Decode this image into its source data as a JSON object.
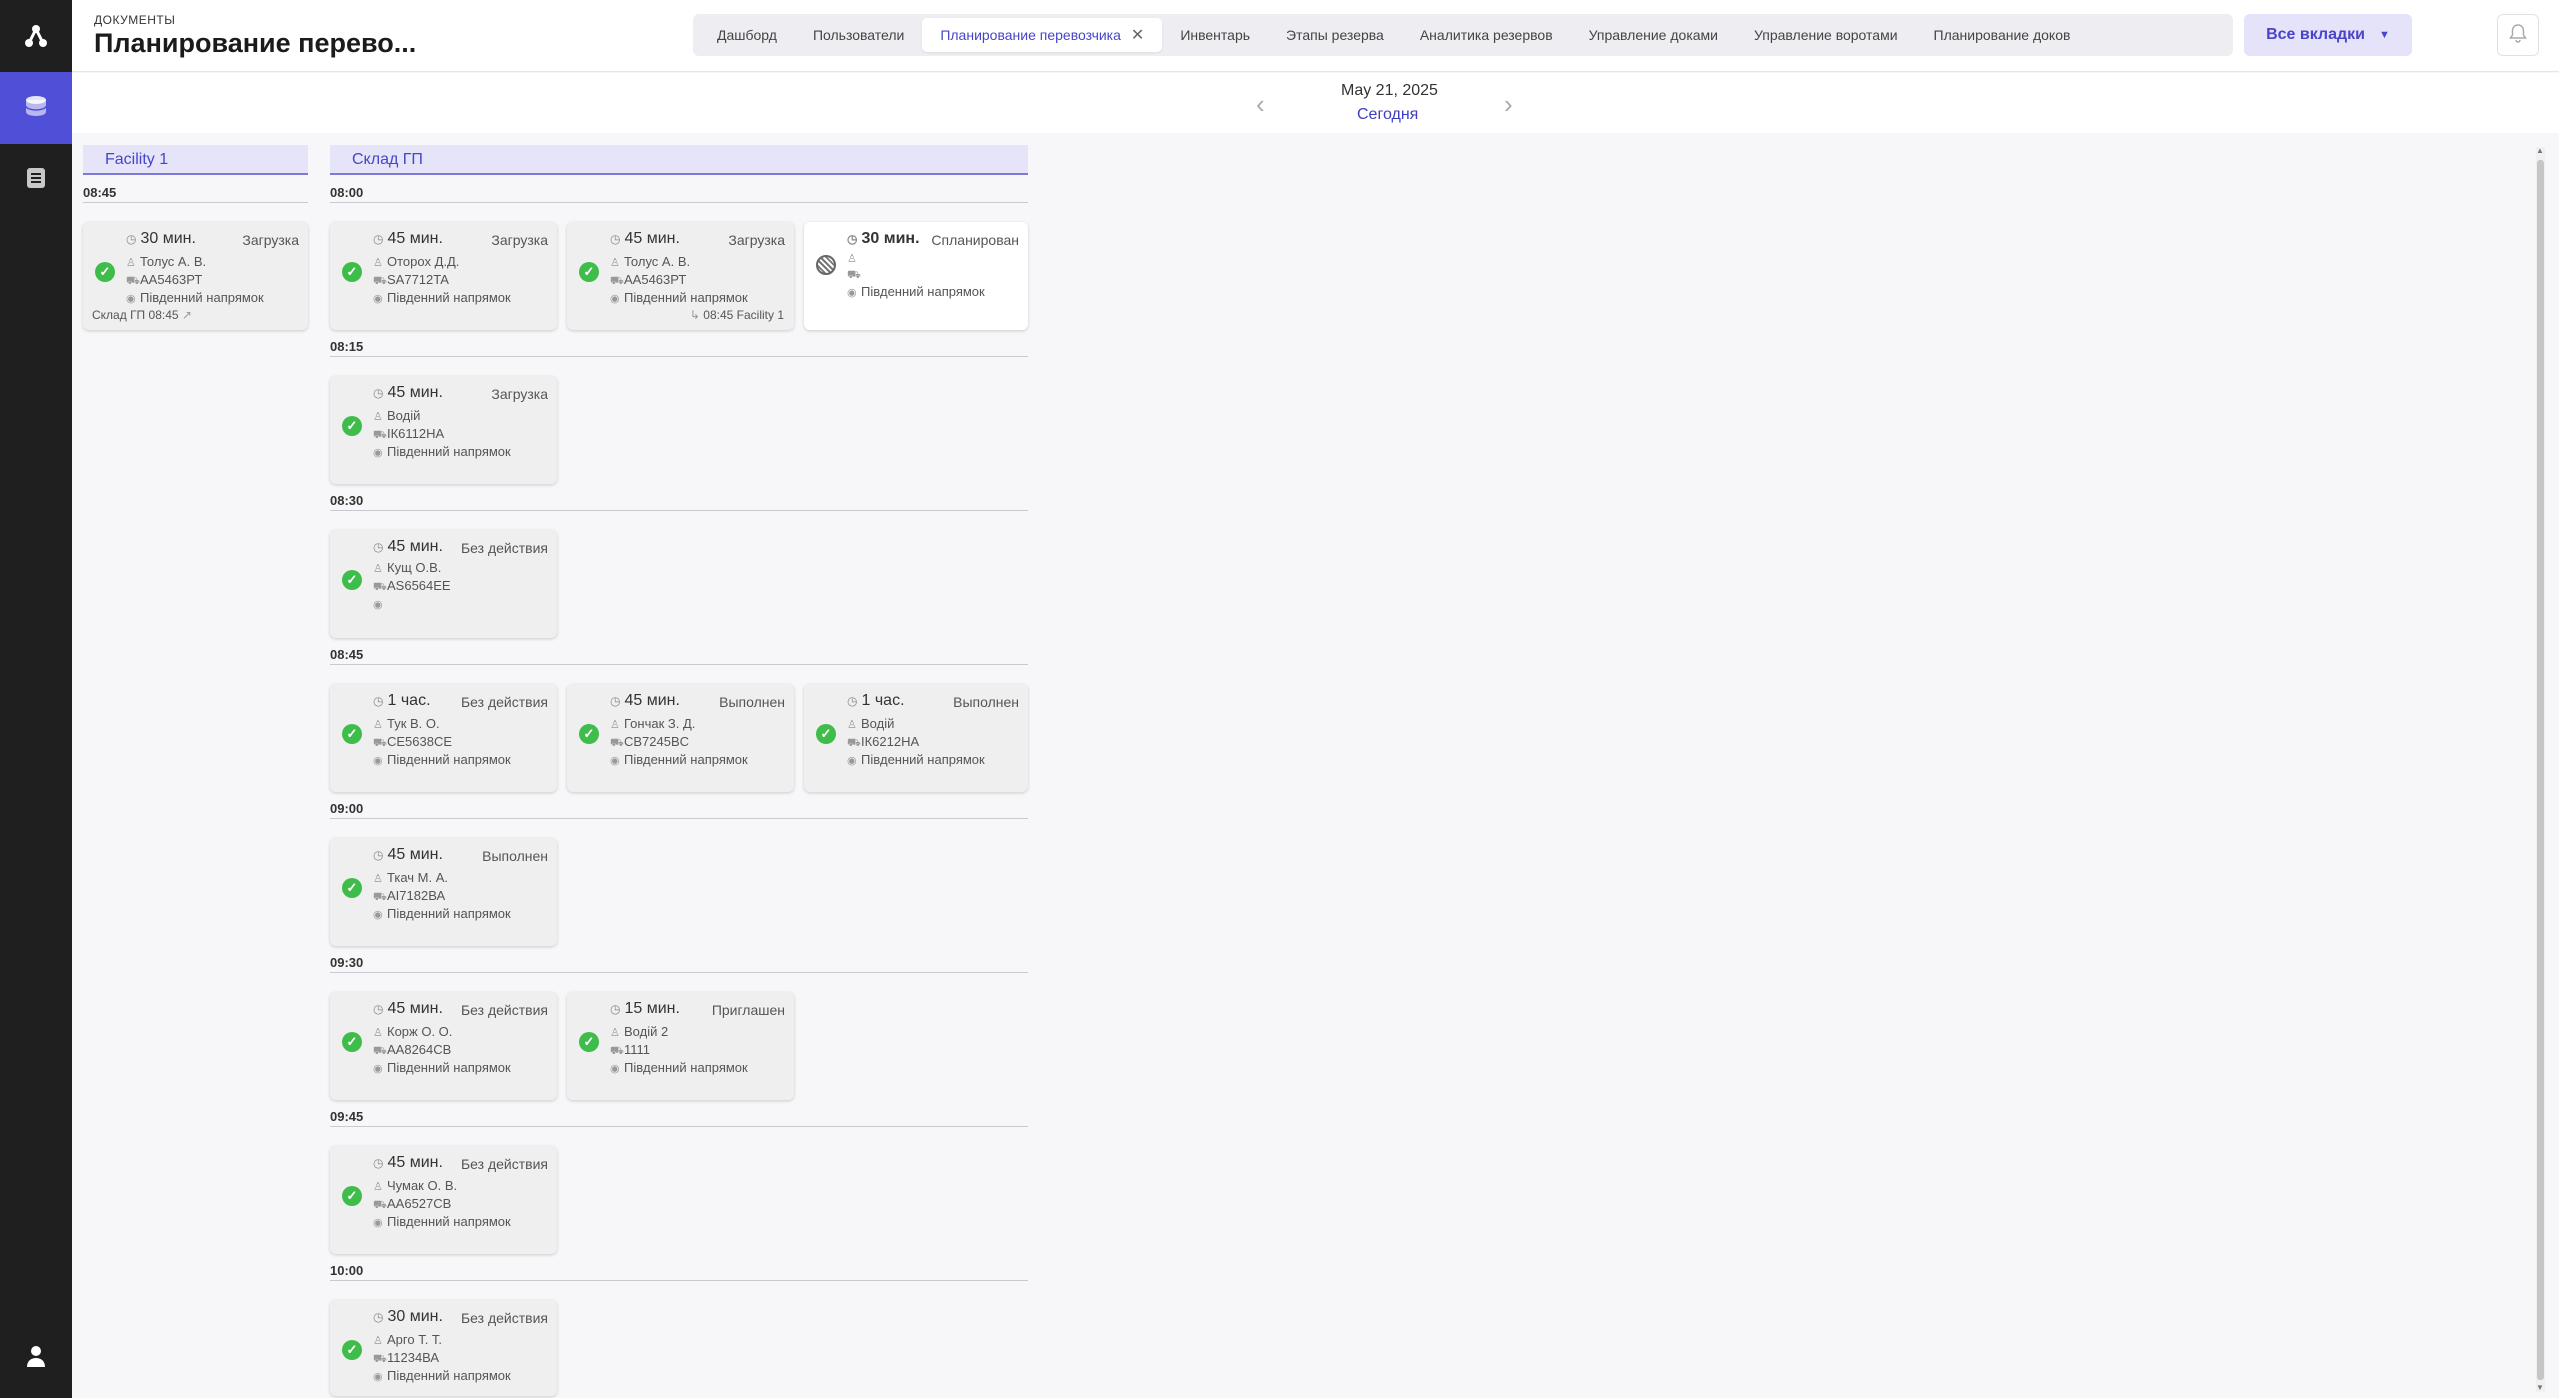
{
  "header": {
    "breadcrumb": "ДОКУМЕНТЫ",
    "title": "Планирование перево...",
    "tabs": [
      {
        "label": "Дашборд"
      },
      {
        "label": "Пользователи"
      },
      {
        "label": "Планирование перевозчика",
        "active": true
      },
      {
        "label": "Инвентарь"
      },
      {
        "label": "Этапы резерва"
      },
      {
        "label": "Аналитика резервов"
      },
      {
        "label": "Управление доками"
      },
      {
        "label": "Управление воротами"
      },
      {
        "label": "Планирование доков"
      }
    ],
    "all_tabs_label": "Все вкладки"
  },
  "date_nav": {
    "date": "May 21, 2025",
    "today": "Сегодня"
  },
  "columns": [
    {
      "name": "Facility 1"
    },
    {
      "name": "Склад ГП"
    }
  ],
  "times": {
    "f1_0845": "08:45",
    "t0800": "08:00",
    "t0815": "08:15",
    "t0830": "08:30",
    "t0845": "08:45",
    "t0900": "09:00",
    "t0930": "09:30",
    "t0945": "09:45",
    "t1000": "10:00"
  },
  "cards": {
    "f1": {
      "duration": "30 мин.",
      "status": "Загрузка",
      "driver": "Толус А. В.",
      "plate": "АА5463РТ",
      "location": "Південний напрямок",
      "footer": "Склад ГП  08:45"
    },
    "a1": {
      "duration": "45 мин.",
      "status": "Загрузка",
      "driver": "Оторох Д.Д.",
      "plate": "SA7712TA",
      "location": "Південний напрямок"
    },
    "a2": {
      "duration": "45 мин.",
      "status": "Загрузка",
      "driver": "Толус А. В.",
      "plate": "АА5463РТ",
      "location": "Південний напрямок",
      "footer": "08:45  Facility 1"
    },
    "a3": {
      "duration": "30 мин.",
      "status": "Спланирован",
      "driver": "",
      "plate": "",
      "location": "Південний напрямок"
    },
    "b1": {
      "duration": "45 мин.",
      "status": "Загрузка",
      "driver": "Водій",
      "plate": "ІК6112НА",
      "location": "Південний напрямок"
    },
    "c1": {
      "duration": "45 мин.",
      "status": "Без действия",
      "driver": "Кущ О.В.",
      "plate": "AS6564EE",
      "location": ""
    },
    "d1": {
      "duration": "1 час.",
      "status": "Без действия",
      "driver": "Тук В. О.",
      "plate": "СЕ5638СЕ",
      "location": "Південний напрямок"
    },
    "d2": {
      "duration": "45 мин.",
      "status": "Выполнен",
      "driver": "Гончак З. Д.",
      "plate": "CB7245BC",
      "location": "Південний напрямок"
    },
    "d3": {
      "duration": "1 час.",
      "status": "Выполнен",
      "driver": "Водій",
      "plate": "ІК6212НА",
      "location": "Південний напрямок"
    },
    "e1": {
      "duration": "45 мин.",
      "status": "Выполнен",
      "driver": "Ткач М. А.",
      "plate": "АІ7182ВА",
      "location": "Південний напрямок"
    },
    "g1": {
      "duration": "45 мин.",
      "status": "Без действия",
      "driver": "Корж О. О.",
      "plate": "АА8264СВ",
      "location": "Південний напрямок"
    },
    "g2": {
      "duration": "15 мин.",
      "status": "Приглашен",
      "driver": "Водій 2",
      "plate": "1111",
      "location": "Південний напрямок"
    },
    "h1": {
      "duration": "45 мин.",
      "status": "Без действия",
      "driver": "Чумак О. В.",
      "plate": "АА6527СВ",
      "location": "Південний напрямок"
    },
    "i1": {
      "duration": "30 мин.",
      "status": "Без действия",
      "driver": "Арго Т. Т.",
      "plate": "11234ВА",
      "location": "Південний напрямок"
    }
  },
  "colors": {
    "accent": "#4f4fd8",
    "success": "#3fbd4a",
    "sidebar": "#1f1f1f"
  }
}
